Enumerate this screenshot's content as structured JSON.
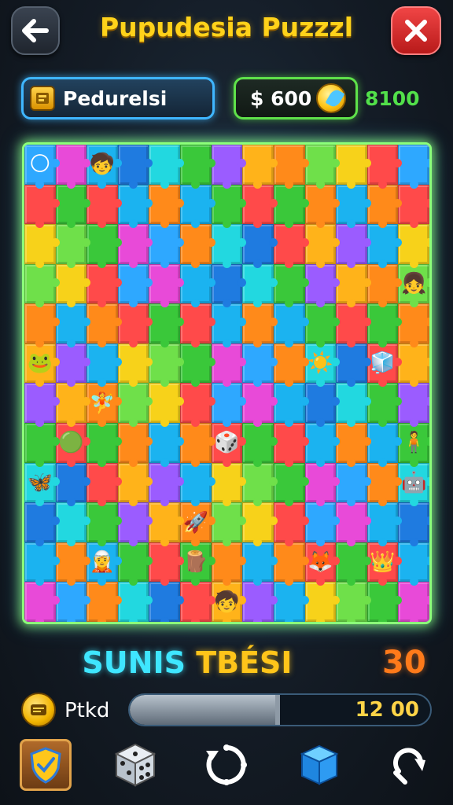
{
  "header": {
    "title": "Pupudesia Puzzzl"
  },
  "info_bar": {
    "player_name": "Pedurelsi",
    "coins": "$ 600",
    "score": "8100"
  },
  "status": {
    "label_part1": "SUNIS",
    "label_part2": "TBÉSI",
    "score": "30"
  },
  "progress": {
    "label": "Ptkd",
    "value_text": "12 00",
    "fill_fraction": 0.5
  },
  "toolbar": {
    "icons": [
      "shield-icon",
      "dice-icon",
      "rotate-icon",
      "cube-icon",
      "redo-icon"
    ]
  },
  "colors": {
    "title": "#ffd21a",
    "player_border": "#3fb6ff",
    "coin_border": "#5fe24a",
    "board_glow": "#8cff7a",
    "status_word1": "#3fe6ff",
    "status_word2": "#ffc51a",
    "status_score": "#ff7a1a",
    "close_button": "#e03030"
  }
}
